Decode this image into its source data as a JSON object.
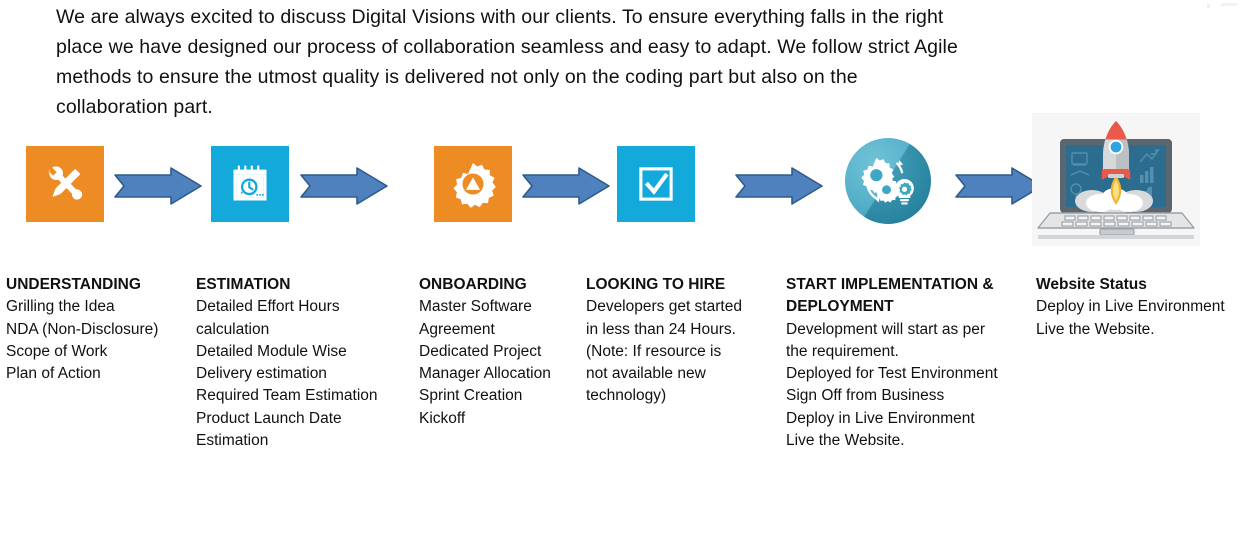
{
  "intro": {
    "line1": "We are always excited to discuss Digital Visions with our clients. To ensure everything falls in the right",
    "line2": "place we have designed our process of collaboration seamless and easy to adapt. We follow strict Agile",
    "line3": "methods to ensure the utmost quality is delivered not only on the coding part but also on the",
    "line4": "collaboration part."
  },
  "colors": {
    "orange": "#ED8B25",
    "cyan": "#13A9DB",
    "arrow_fill": "#4E81BD",
    "arrow_stroke": "#2E5B8C",
    "teal": "#3EA7C4",
    "rocket_red": "#E8594A",
    "screen_blue": "#2C6C8F"
  },
  "process": {
    "steps": [
      {
        "icon": "wrench-pencil-icon",
        "shape": "square-orange"
      },
      {
        "icon": "calendar-clock-icon",
        "shape": "square-cyan"
      },
      {
        "icon": "gear-alert-icon",
        "shape": "square-orange"
      },
      {
        "icon": "checkbox-check-icon",
        "shape": "square-cyan"
      },
      {
        "icon": "gears-lightbulb-icon",
        "shape": "circle-teal"
      },
      {
        "icon": "laptop-rocket-launch-icon",
        "shape": "image"
      }
    ],
    "connector": "right-arrow-icon",
    "connector_count": 5
  },
  "columns": [
    {
      "title": "UNDERSTANDING",
      "body": "Grilling the Idea\nNDA (Non-Disclosure)\nScope of Work\nPlan of Action"
    },
    {
      "title": "ESTIMATION",
      "body": "Detailed Effort Hours\ncalculation\nDetailed Module Wise\nDelivery estimation\nRequired Team Estimation\nProduct Launch Date\nEstimation"
    },
    {
      "title": "ONBOARDING",
      "body": "Master Software\nAgreement\nDedicated Project\nManager Allocation\nSprint Creation\nKickoff"
    },
    {
      "title": "LOOKING TO HIRE",
      "body": "Developers get started\nin less than 24 Hours.\n(Note: If resource is\nnot available new\ntechnology)"
    },
    {
      "title": "START IMPLEMENTATION &\nDEPLOYMENT",
      "body": "Development will start  as per\nthe requirement.\nDeployed for Test Environment\nSign Off from Business\nDeploy in Live Environment\nLive the Website."
    },
    {
      "title": "Website  Status",
      "body": "Deploy in Live Environment\nLive the Website."
    }
  ]
}
